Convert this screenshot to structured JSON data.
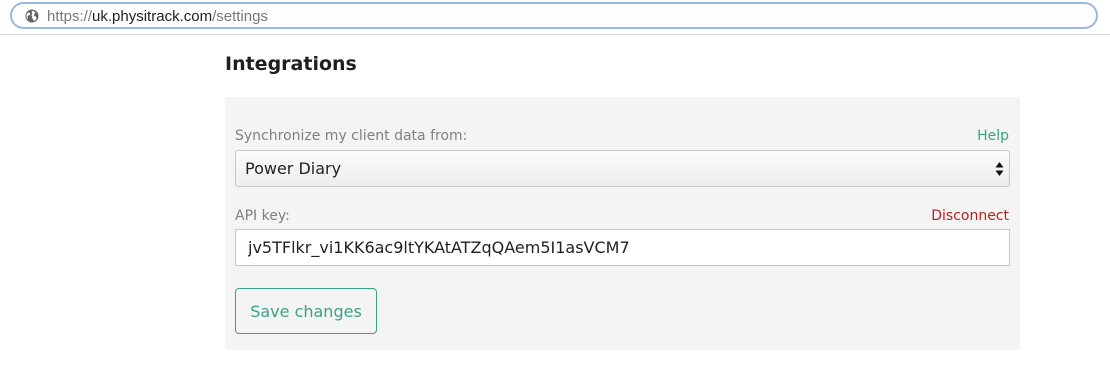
{
  "browser": {
    "url_scheme": "https://",
    "url_host": "uk.physitrack.com",
    "url_path": "/settings",
    "site_icon": "globe-icon"
  },
  "page": {
    "title": "Integrations"
  },
  "integrations": {
    "sync_label": "Synchronize my client data from:",
    "help_label": "Help",
    "provider_selected": "Power Diary",
    "api_key_label": "API key:",
    "disconnect_label": "Disconnect",
    "api_key_value": "jv5TFlkr_vi1KK6ac9ltYKAtATZqQAem5I1asVCM7",
    "save_label": "Save changes"
  },
  "colors": {
    "accent": "#3aa387",
    "danger": "#b52222",
    "panel_bg": "#f4f4f4",
    "url_border": "#9db8dd"
  }
}
